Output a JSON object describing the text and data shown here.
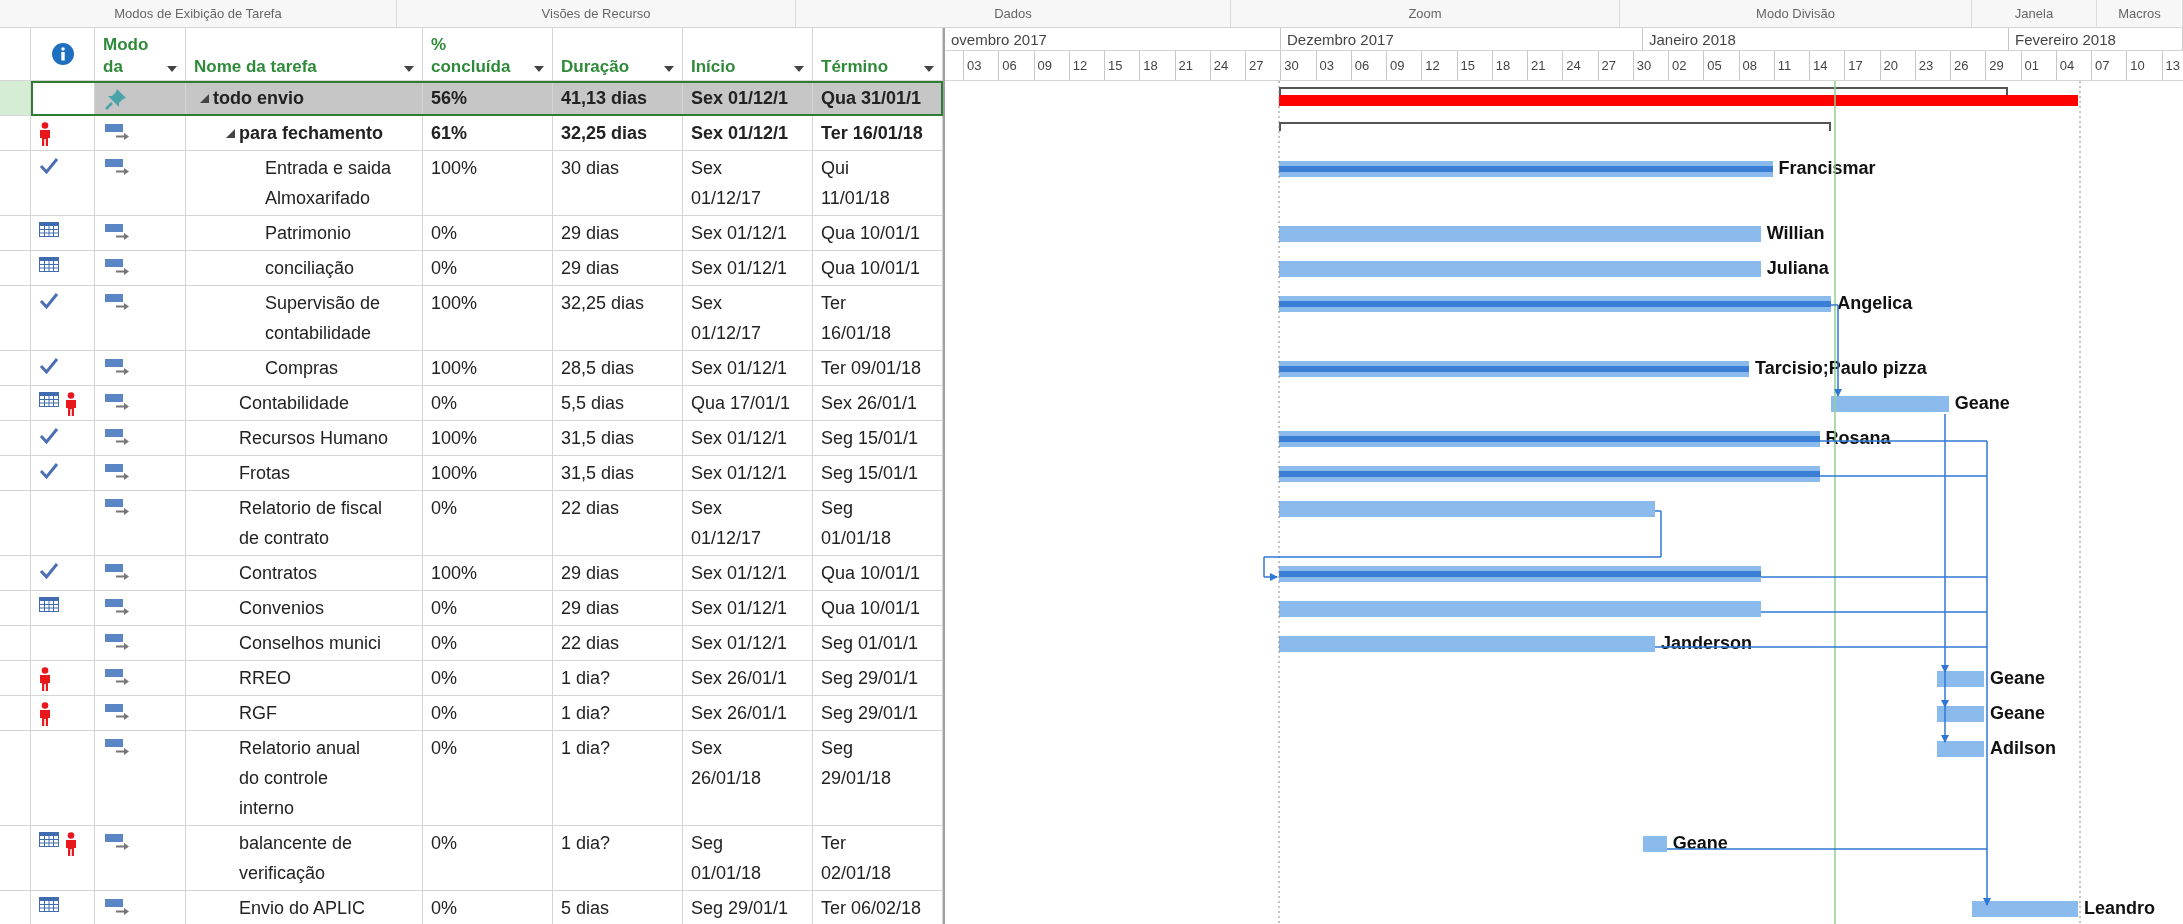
{
  "ribbon_groups": [
    {
      "label": "Modos de Exibição de Tarefa"
    },
    {
      "label": "Visões de Recurso"
    },
    {
      "label": "Dados"
    },
    {
      "label": "Zoom"
    },
    {
      "label": "Modo Divisão"
    },
    {
      "label": "Janela"
    },
    {
      "label": "Macros"
    }
  ],
  "table": {
    "columns": [
      {
        "label": "Modo da"
      },
      {
        "label": "Nome da tarefa"
      },
      {
        "label": "% concluída"
      },
      {
        "label": "Duração"
      },
      {
        "label": "Início"
      },
      {
        "label": "Término"
      }
    ],
    "tasks": [
      {
        "name": "todo envio",
        "mode": {
          "kind": "pinned"
        },
        "percent": "56%",
        "duration": "41,13 dias",
        "start": "Sex 01/12/1",
        "finish": "Qua 31/01/1",
        "selected": true,
        "multiline": false,
        "expanded": true,
        "critical": true,
        "children": [
          {
            "name": "para fechamento",
            "indicators": [
              {
                "kind": "person"
              }
            ],
            "mode": {
              "kind": "auto"
            },
            "percent": "61%",
            "duration": "32,25 dias",
            "start": "Sex 01/12/1",
            "finish": "Ter 16/01/18",
            "selected": false,
            "multiline": false,
            "expanded": true,
            "critical": false,
            "children": [
              {
                "name": "Entrada e saida Almoxarifado",
                "indicators": [
                  {
                    "kind": "check"
                  }
                ],
                "mode": {
                  "kind": "auto"
                },
                "percent": "100%",
                "duration": "30 dias",
                "start": "Sex 01/12/17",
                "finish": "Qui 11/01/18",
                "selected": false,
                "multiline": true,
                "resource": "Francismar"
              },
              {
                "name": "Patrimonio",
                "indicators": [
                  {
                    "kind": "calendar"
                  }
                ],
                "mode": {
                  "kind": "auto"
                },
                "percent": "0%",
                "duration": "29 dias",
                "start": "Sex 01/12/1",
                "finish": "Qua 10/01/1",
                "selected": false,
                "multiline": false,
                "resource": "Willian"
              },
              {
                "name": "conciliação",
                "indicators": [
                  {
                    "kind": "calendar"
                  }
                ],
                "mode": {
                  "kind": "auto"
                },
                "percent": "0%",
                "duration": "29 dias",
                "start": "Sex 01/12/1",
                "finish": "Qua 10/01/1",
                "selected": false,
                "multiline": false,
                "resource": "Juliana"
              },
              {
                "name": "Supervisão de contabilidade",
                "indicators": [
                  {
                    "kind": "check"
                  }
                ],
                "mode": {
                  "kind": "auto"
                },
                "percent": "100%",
                "duration": "32,25 dias",
                "start": "Sex 01/12/17",
                "finish": "Ter 16/01/18",
                "selected": false,
                "multiline": true,
                "resource": "Angelica"
              },
              {
                "name": "Compras",
                "indicators": [
                  {
                    "kind": "check"
                  }
                ],
                "mode": {
                  "kind": "auto"
                },
                "percent": "100%",
                "duration": "28,5 dias",
                "start": "Sex 01/12/1",
                "finish": "Ter 09/01/18",
                "selected": false,
                "multiline": false,
                "resource": "Tarcisio;Paulo pizza"
              }
            ]
          },
          {
            "name": "Contabilidade",
            "indicators": [
              {
                "kind": "calendar"
              },
              {
                "kind": "person"
              }
            ],
            "mode": {
              "kind": "auto"
            },
            "percent": "0%",
            "duration": "5,5 dias",
            "start": "Qua 17/01/1",
            "finish": "Sex 26/01/1",
            "selected": false,
            "multiline": false,
            "resource": "Geane"
          },
          {
            "name": "Recursos Humano",
            "indicators": [
              {
                "kind": "check"
              }
            ],
            "mode": {
              "kind": "auto"
            },
            "percent": "100%",
            "duration": "31,5 dias",
            "start": "Sex 01/12/1",
            "finish": "Seg 15/01/1",
            "selected": false,
            "multiline": false,
            "resource": "Rosana"
          },
          {
            "name": "Frotas",
            "indicators": [
              {
                "kind": "check"
              }
            ],
            "mode": {
              "kind": "auto"
            },
            "percent": "100%",
            "duration": "31,5 dias",
            "start": "Sex 01/12/1",
            "finish": "Seg 15/01/1",
            "selected": false,
            "multiline": false
          },
          {
            "name": "Relatorio de fiscal de contrato",
            "mode": {
              "kind": "auto"
            },
            "percent": "0%",
            "duration": "22 dias",
            "start": "Sex 01/12/17",
            "finish": "Seg 01/01/18",
            "selected": false,
            "multiline": true
          },
          {
            "name": "Contratos",
            "indicators": [
              {
                "kind": "check"
              }
            ],
            "mode": {
              "kind": "auto"
            },
            "percent": "100%",
            "duration": "29 dias",
            "start": "Sex 01/12/1",
            "finish": "Qua 10/01/1",
            "selected": false,
            "multiline": false
          },
          {
            "name": "Convenios",
            "indicators": [
              {
                "kind": "calendar"
              }
            ],
            "mode": {
              "kind": "auto"
            },
            "percent": "0%",
            "duration": "29 dias",
            "start": "Sex 01/12/1",
            "finish": "Qua 10/01/1",
            "selected": false,
            "multiline": false
          },
          {
            "name": "Conselhos munici",
            "mode": {
              "kind": "auto"
            },
            "percent": "0%",
            "duration": "22 dias",
            "start": "Sex 01/12/1",
            "finish": "Seg 01/01/1",
            "selected": false,
            "multiline": false,
            "resource": "Janderson"
          },
          {
            "name": "RREO",
            "indicators": [
              {
                "kind": "person"
              }
            ],
            "mode": {
              "kind": "auto"
            },
            "percent": "0%",
            "duration": "1 dia?",
            "start": "Sex 26/01/1",
            "finish": "Seg 29/01/1",
            "selected": false,
            "multiline": false,
            "resource": "Geane"
          },
          {
            "name": "RGF",
            "indicators": [
              {
                "kind": "person"
              }
            ],
            "mode": {
              "kind": "auto"
            },
            "percent": "0%",
            "duration": "1 dia?",
            "start": "Sex 26/01/1",
            "finish": "Seg 29/01/1",
            "selected": false,
            "multiline": false,
            "resource": "Geane"
          },
          {
            "name": "Relatorio anual do controle interno",
            "mode": {
              "kind": "auto"
            },
            "percent": "0%",
            "duration": "1 dia?",
            "start": "Sex 26/01/18",
            "finish": "Seg 29/01/18",
            "selected": false,
            "multiline": true,
            "resource": "Adilson"
          },
          {
            "name": "balancente de verificação",
            "indicators": [
              {
                "kind": "calendar"
              },
              {
                "kind": "person"
              }
            ],
            "mode": {
              "kind": "auto"
            },
            "percent": "0%",
            "duration": "1 dia?",
            "start": "Seg 01/01/18",
            "finish": "Ter 02/01/18",
            "selected": false,
            "multiline": true,
            "resource": "Geane"
          },
          {
            "name": "Envio do APLIC",
            "indicators": [
              {
                "kind": "calendar"
              }
            ],
            "mode": {
              "kind": "auto"
            },
            "percent": "0%",
            "duration": "5 dias",
            "start": "Seg 29/01/1",
            "finish": "Ter 06/02/18",
            "selected": false,
            "multiline": false,
            "resource": "Leandro"
          }
        ]
      }
    ]
  },
  "timescale": {
    "months": [
      {
        "label": "ovembro 2017"
      },
      {
        "label": "Dezembro 2017"
      },
      {
        "label": "Janeiro 2018"
      },
      {
        "label": "Fevereiro 2018"
      }
    ],
    "days": [
      "03",
      "06",
      "09",
      "12",
      "15",
      "18",
      "21",
      "24",
      "27",
      "30",
      "03",
      "06",
      "09",
      "12",
      "15",
      "18",
      "21",
      "24",
      "27",
      "30",
      "02",
      "05",
      "08",
      "11",
      "14",
      "17",
      "20",
      "23",
      "26",
      "29",
      "01",
      "04",
      "07",
      "10",
      "13"
    ]
  }
}
